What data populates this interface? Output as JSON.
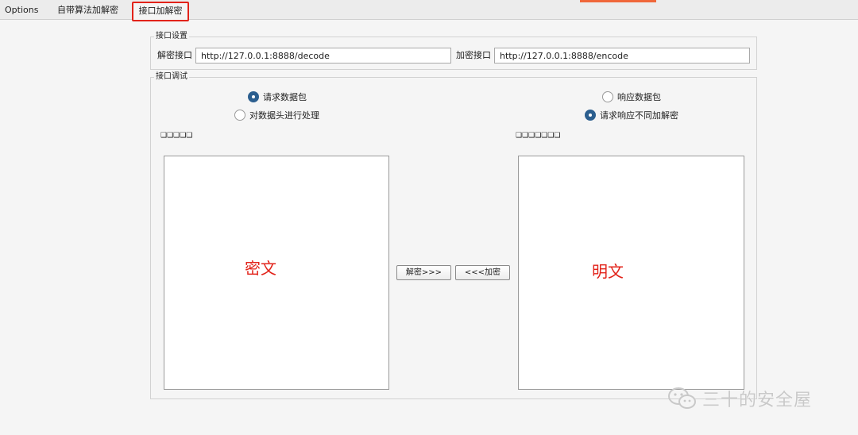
{
  "tabs": [
    {
      "label": "Options"
    },
    {
      "label": "自带算法加解密"
    },
    {
      "label": "接口加解密"
    }
  ],
  "settings": {
    "legend": "接口设置",
    "decode_label": "解密接口",
    "decode_value": "http://127.0.0.1:8888/decode",
    "encode_label": "加密接口",
    "encode_value": "http://127.0.0.1:8888/encode"
  },
  "debug": {
    "legend": "接口调试",
    "radio_request": "请求数据包",
    "radio_headers": "对数据头进行处理",
    "radio_response": "响应数据包",
    "radio_response_diff": "请求响应不同加解密",
    "left_box_label": "❑❑❑❑❑",
    "right_box_label": "❑❑❑❑❑❑❑",
    "cipher_overlay": "密文",
    "plain_overlay": "明文",
    "decrypt_button": "解密>>>",
    "encrypt_button": "<<<加密"
  },
  "watermark": {
    "text": "三十的安全屋"
  },
  "colors": {
    "accent": "#f0673a",
    "highlight": "#e2231a",
    "radio_selected": "#2c5f8f"
  }
}
